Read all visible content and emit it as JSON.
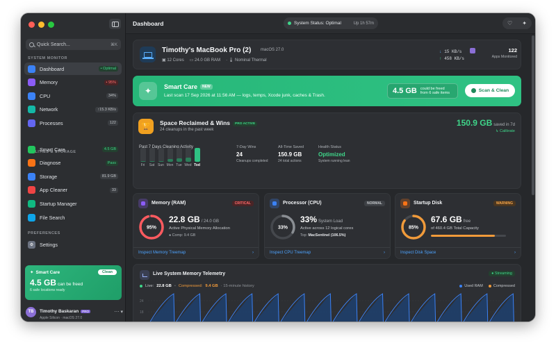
{
  "sidebar": {
    "search_placeholder": "Quick Search...",
    "search_shortcut": "⌘K",
    "section_monitor": "SYSTEM MONITOR",
    "section_utilities": "UTILITIES & STORAGE",
    "section_preferences": "PREFERENCES",
    "monitor_items": [
      {
        "label": "Dashboard",
        "badge": "• Optimal",
        "icon": "gauge-icon",
        "color": "#3b82f6"
      },
      {
        "label": "Memory",
        "badge": "• 95%",
        "icon": "memory-icon",
        "color": "#8b5cf6"
      },
      {
        "label": "CPU",
        "badge": "34%",
        "icon": "cpu-icon",
        "color": "#3b82f6"
      },
      {
        "label": "Network",
        "badge": "↑15.3 KB/s",
        "icon": "network-icon",
        "color": "#14b8a6"
      },
      {
        "label": "Processes",
        "badge": "122",
        "icon": "processes-icon",
        "color": "#6366f1"
      }
    ],
    "utility_items": [
      {
        "label": "Smart Care",
        "badge": "4.5 GB",
        "icon": "sparkle-icon",
        "color": "#22c55e"
      },
      {
        "label": "Diagnose",
        "badge": "Pass",
        "icon": "diagnose-icon",
        "color": "#f97316"
      },
      {
        "label": "Storage",
        "badge": "81.9 GB",
        "icon": "storage-icon",
        "color": "#3b82f6"
      },
      {
        "label": "App Cleaner",
        "badge": "33",
        "icon": "app-cleaner-icon",
        "color": "#ef4444"
      },
      {
        "label": "Startup Manager",
        "badge": "",
        "icon": "power-icon",
        "color": "#10b981"
      },
      {
        "label": "File Search",
        "badge": "",
        "icon": "file-search-icon",
        "color": "#0ea5e9"
      }
    ],
    "settings_label": "Settings",
    "smart_care_card": {
      "title": "Smart Care",
      "button": "Clean",
      "value": "4.5 GB",
      "value_suffix": "can be freed",
      "sub": "6 safe locations ready"
    },
    "user": {
      "initials": "TB",
      "name": "Timothy Baskaran",
      "badge": "PRO",
      "device": "Apple Silicon · macOS 27.0",
      "more": "⋯ ▾"
    }
  },
  "header": {
    "title": "Dashboard",
    "status": "System Status: Optimal",
    "uptime": "Up 1h 57m"
  },
  "device": {
    "name": "Timothy's MacBook Pro (2)",
    "os": "macOS 27.0",
    "cores": "12 Cores",
    "ram": "24.0 GB RAM",
    "thermal": "Nominal Thermal",
    "net_down": "15 KB/s",
    "net_up": "458 KB/s",
    "apps_count": "122",
    "apps_label": "Apps Monitored"
  },
  "banner": {
    "title": "Smart Care",
    "tag": "NEW",
    "subtitle": "Last scan 17 Sep 2026 at 11:56 AM — logs, temps, Xcode junk, caches & Trash.",
    "value": "4.5 GB",
    "caption_1": "could be freed",
    "caption_2": "from 6 safe items",
    "button": "Scan & Clean"
  },
  "reclaimed": {
    "title": "Space Reclaimed & Wins",
    "tag": "PRO ACTIVE",
    "subtitle": "24 cleanups in the past week",
    "big": "150.9 GB",
    "big_suffix": "saved in 7d",
    "calibrate": "↳ Calibrate",
    "activity_label": "Past 7 Days Cleaning Activity",
    "days": [
      "Fri",
      "Sat",
      "Sun",
      "Mon",
      "Tue",
      "Wed",
      "Tod"
    ],
    "day_levels": [
      0.05,
      0.05,
      0.05,
      0.2,
      0.25,
      0.3,
      1.0
    ],
    "stats": [
      {
        "head": "7-Day Wins",
        "value": "24",
        "sub": "Cleanups completed"
      },
      {
        "head": "All-Time Saved",
        "value": "150.9 GB",
        "sub": "24 total actions"
      },
      {
        "head": "Health Status",
        "value": "Optimized",
        "sub": "System running lean"
      }
    ]
  },
  "resources": [
    {
      "title": "Memory (RAM)",
      "badge": "CRITICAL",
      "badge_color": "#ff6b6b",
      "badge_bg": "#4a2426",
      "icon_color": "#8b5cf6",
      "percent_label": "95%",
      "percent": 0.95,
      "ring_color": "#ff5a5f",
      "value": "22.8 GB",
      "value_suffix": "/ 24.0 GB",
      "sub": "Active Physical Memory Allocation",
      "sub2": "● Comp: 9.4 GB",
      "sub2_bold": "",
      "link": "Inspect Memory Treemap",
      "icon": "memory-chip-icon"
    },
    {
      "title": "Processor (CPU)",
      "badge": "NORMAL",
      "badge_color": "#c3c6ca",
      "badge_bg": "#3d4045",
      "icon_color": "#3b82f6",
      "percent_label": "33%",
      "percent": 0.33,
      "ring_color": "#8a8e93",
      "value": "33%",
      "value_suffix": "System Load",
      "sub": "Active across 12 logical cores",
      "sub2": "Top: ",
      "sub2_bold": "MacSentinel (106.5%)",
      "link": "Inspect CPU Treemap",
      "icon": "processor-icon"
    },
    {
      "title": "Startup Disk",
      "badge": "WARNING",
      "badge_color": "#f5a54a",
      "badge_bg": "#4a3620",
      "icon_color": "#f97316",
      "percent_label": "85%",
      "percent": 0.85,
      "ring_color": "#f09a3a",
      "value": "67.6 GB",
      "value_suffix": "free",
      "sub": "of 460.4 GB Total Capacity",
      "sub2": "",
      "sub2_bold": "",
      "link": "Inspect Disk Space",
      "icon": "disk-icon"
    }
  ],
  "telemetry": {
    "title": "Live System Memory Telemetry",
    "streaming": "● Streaming",
    "live_label": "Live:",
    "live_value": "22.8 GB",
    "compressed_label": "Compressed:",
    "compressed_value": "9.4 GB",
    "window": "· 15-minute history",
    "key_used": "Used RAM",
    "key_compressed": "Compressed",
    "y_ticks": [
      "24",
      "18"
    ],
    "used_color": "#3b82f6",
    "compressed_color": "#f09a3a"
  }
}
